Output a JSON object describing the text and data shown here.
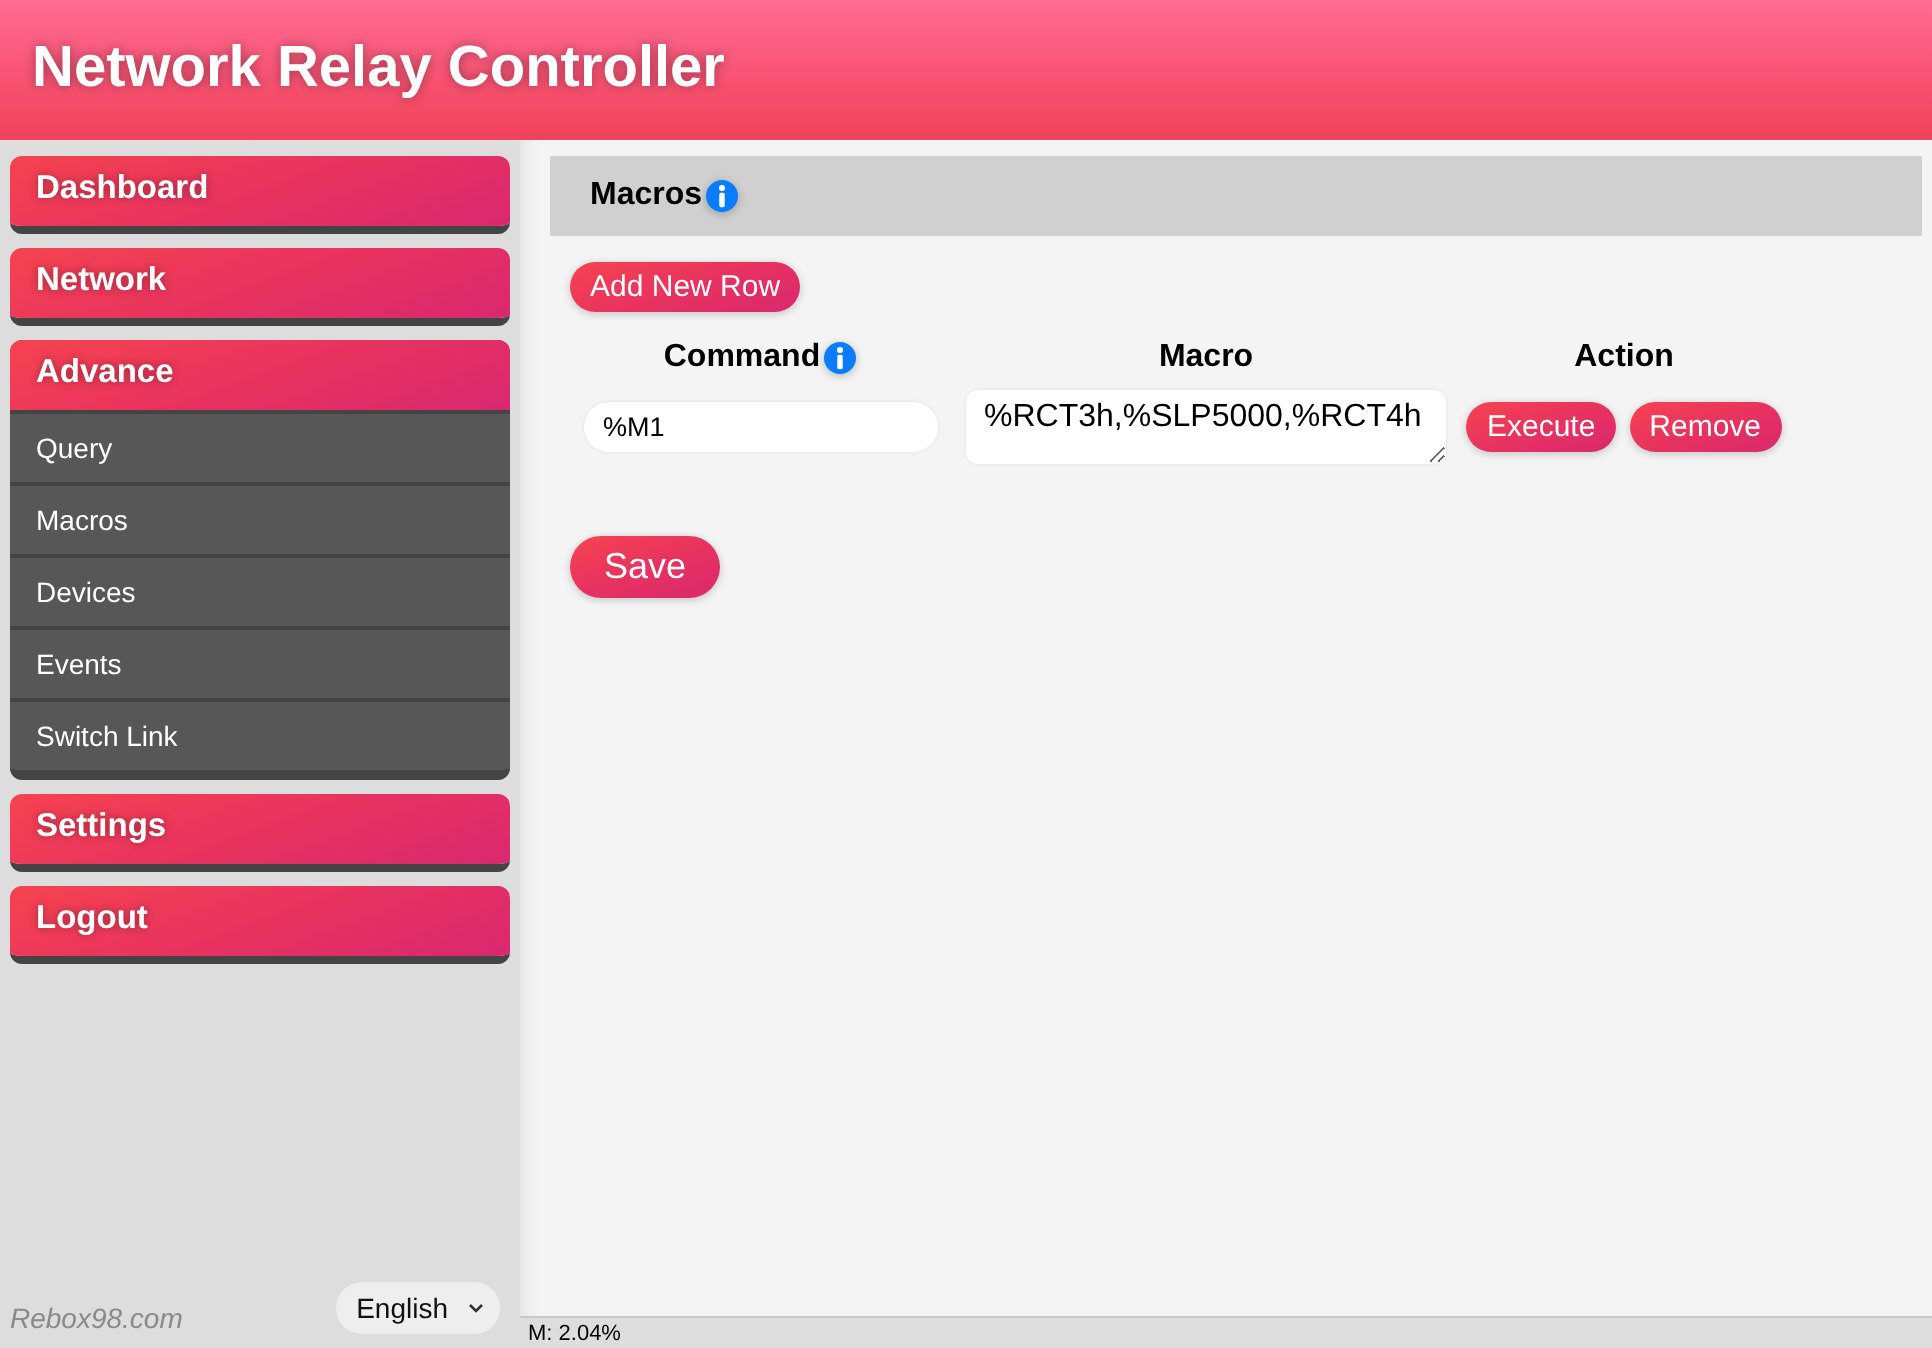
{
  "header": {
    "title": "Network Relay Controller"
  },
  "sidebar": {
    "menu": [
      {
        "label": "Dashboard"
      },
      {
        "label": "Network"
      },
      {
        "label": "Advance",
        "children": [
          {
            "label": "Query"
          },
          {
            "label": "Macros"
          },
          {
            "label": "Devices"
          },
          {
            "label": "Events"
          },
          {
            "label": "Switch Link"
          }
        ]
      },
      {
        "label": "Settings"
      },
      {
        "label": "Logout"
      }
    ],
    "footer": {
      "brand": "Rebox98.com",
      "language": "English"
    }
  },
  "panel": {
    "title": "Macros",
    "add_button": "Add New Row",
    "columns": [
      {
        "label": "Command",
        "info": true
      },
      {
        "label": "Macro",
        "info": false
      },
      {
        "label": "Action",
        "info": false
      }
    ],
    "rows": [
      {
        "command": "%M1",
        "macro": "%RCT3h,%SLP5000,%RCT4h",
        "actions": [
          "Execute",
          "Remove"
        ]
      }
    ],
    "save_button": "Save"
  },
  "status_bar": {
    "memory": "M: 2.04%"
  }
}
